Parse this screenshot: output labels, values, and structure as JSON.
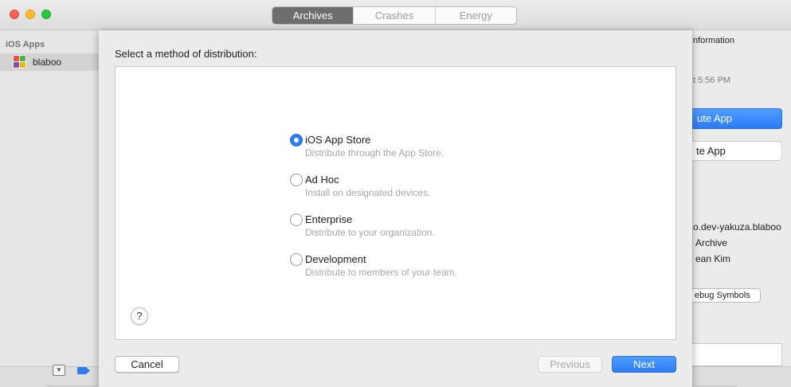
{
  "window": {
    "tabs": [
      {
        "label": "Archives",
        "active": true
      },
      {
        "label": "Crashes",
        "active": false
      },
      {
        "label": "Energy",
        "active": false
      }
    ]
  },
  "sidebar": {
    "section_header": "iOS Apps",
    "items": [
      {
        "label": "blaboo",
        "icon": "app-icon",
        "selected": true
      }
    ]
  },
  "right_panel": {
    "info_heading": "nformation",
    "time_fragment": "t 5:56 PM",
    "primary_button": "ute App",
    "secondary_button": "te App",
    "identifier": "o.dev-yakuza.blaboo",
    "type": "Archive",
    "creator": "ean Kim",
    "debug_button": "ebug Symbols"
  },
  "sheet": {
    "title": "Select a method of distribution:",
    "selected_option": "iOS App Store",
    "options": [
      {
        "label": "iOS App Store",
        "description": "Distribute through the App Store.",
        "checked": true
      },
      {
        "label": "Ad Hoc",
        "description": "Install on designated devices.",
        "checked": false
      },
      {
        "label": "Enterprise",
        "description": "Distribute to your organization.",
        "checked": false
      },
      {
        "label": "Development",
        "description": "Distribute to members of your team.",
        "checked": false
      }
    ],
    "help_label": "?",
    "buttons": {
      "cancel": "Cancel",
      "previous": "Previous",
      "next": "Next"
    }
  },
  "colors": {
    "accent": "#2c7cf6",
    "active_tab": "#6e6e6e",
    "disabled_text": "#a8a8a8",
    "description_text": "#a7a7a7"
  }
}
